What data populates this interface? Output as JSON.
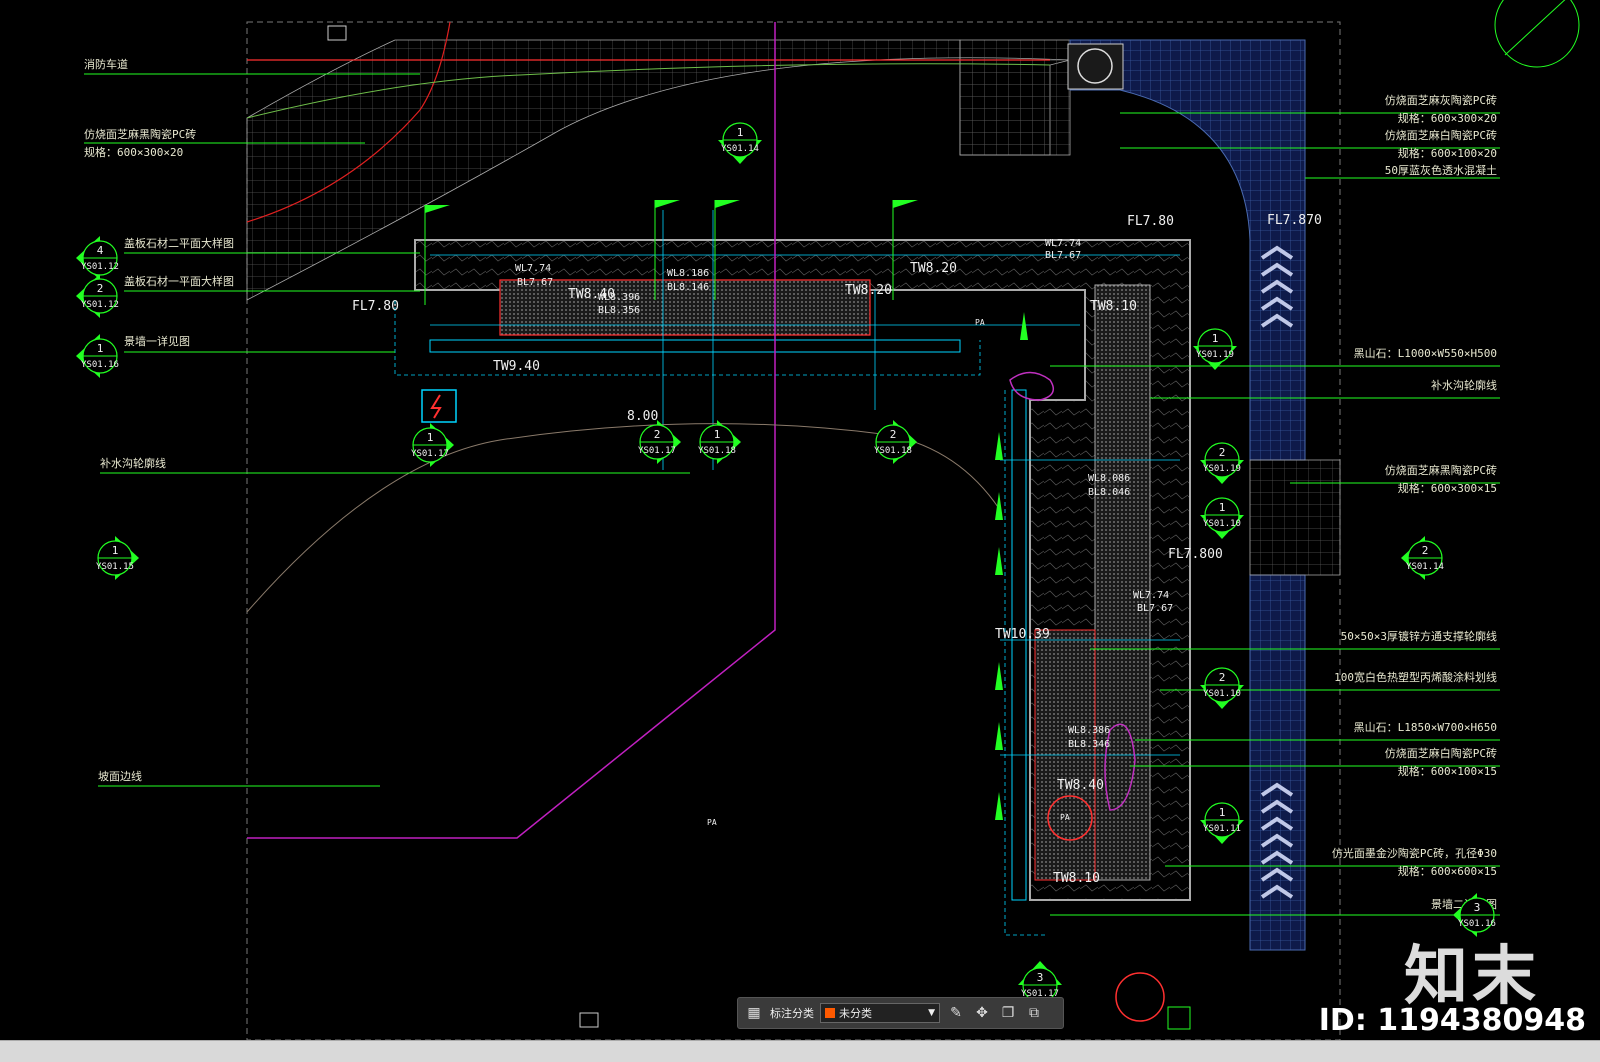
{
  "left_labels": [
    {
      "text": "消防车道"
    },
    {
      "text": "仿烧面芝麻黑陶瓷PC砖"
    },
    {
      "text": "规格：600×300×20"
    },
    {
      "text": "盖板石材二平面大样图"
    },
    {
      "text": "盖板石材一平面大样图"
    },
    {
      "text": "景墙一详见图"
    },
    {
      "text": "补水沟轮廓线"
    },
    {
      "text": "坡面边线"
    }
  ],
  "right_labels": [
    {
      "text": "仿烧面芝麻灰陶瓷PC砖"
    },
    {
      "text": "规格：600×300×20"
    },
    {
      "text": "仿烧面芝麻白陶瓷PC砖"
    },
    {
      "text": "规格：600×100×20"
    },
    {
      "text": "50厚蓝灰色透水混凝土"
    },
    {
      "text": "黑山石：L1000×W550×H500"
    },
    {
      "text": "补水沟轮廓线"
    },
    {
      "text": "仿烧面芝麻黑陶瓷PC砖"
    },
    {
      "text": "规格：600×300×15"
    },
    {
      "text": "50×50×3厚镀锌方通支撑轮廓线"
    },
    {
      "text": "100宽白色热塑型丙烯酸涂料划线"
    },
    {
      "text": "黑山石：L1850×W700×H650"
    },
    {
      "text": "仿烧面芝麻白陶瓷PC砖"
    },
    {
      "text": "规格：600×100×15"
    },
    {
      "text": "仿光面墨金沙陶瓷PC砖，孔径Φ30"
    },
    {
      "text": "规格：600×600×15"
    },
    {
      "text": "景墙二详见图"
    }
  ],
  "elevations": [
    {
      "text": "FL7.80"
    },
    {
      "text": "FL7.870"
    },
    {
      "text": "FL7.80"
    },
    {
      "text": "FL7.800"
    },
    {
      "text": "WL7.74"
    },
    {
      "text": "BL7.67"
    },
    {
      "text": "WL7.74"
    },
    {
      "text": "BL7.67"
    },
    {
      "text": "WL7.74"
    },
    {
      "text": "BL7.67"
    },
    {
      "text": "WL8.186"
    },
    {
      "text": "BL8.146"
    },
    {
      "text": "WL8.396"
    },
    {
      "text": "BL8.356"
    },
    {
      "text": "WL8.086"
    },
    {
      "text": "BL8.046"
    },
    {
      "text": "WL8.386"
    },
    {
      "text": "BL8.346"
    },
    {
      "text": "TW8.20"
    },
    {
      "text": "TW8.20"
    },
    {
      "text": "TW8.40"
    },
    {
      "text": "TW8.10"
    },
    {
      "text": "TW9.40"
    },
    {
      "text": "TW10.39"
    },
    {
      "text": "TW8.40"
    },
    {
      "text": "TW8.10"
    },
    {
      "text": "8.00"
    },
    {
      "text": "PA"
    },
    {
      "text": "PA"
    },
    {
      "text": "PA"
    }
  ],
  "section_markers": [
    {
      "num": "1",
      "ref": "YS01.14"
    },
    {
      "num": "4",
      "ref": "YS01.12"
    },
    {
      "num": "2",
      "ref": "YS01.12"
    },
    {
      "num": "1",
      "ref": "YS01.16"
    },
    {
      "num": "1",
      "ref": "YS01.17"
    },
    {
      "num": "2",
      "ref": "YS01.17"
    },
    {
      "num": "1",
      "ref": "YS01.18"
    },
    {
      "num": "2",
      "ref": "YS01.18"
    },
    {
      "num": "1",
      "ref": "YS01.15"
    },
    {
      "num": "1",
      "ref": "YS01.19"
    },
    {
      "num": "2",
      "ref": "YS01.19"
    },
    {
      "num": "1",
      "ref": "YS01.10"
    },
    {
      "num": "2",
      "ref": "YS01.10"
    },
    {
      "num": "1",
      "ref": "YS01.11"
    },
    {
      "num": "2",
      "ref": "YS01.14"
    },
    {
      "num": "3",
      "ref": "YS01.17"
    },
    {
      "num": "3",
      "ref": "YS01.16"
    }
  ],
  "toolbar": {
    "category_label": "标注分类",
    "selected_value": "未分类"
  },
  "watermark": {
    "brand": "知末",
    "id_text": "ID: 1194380948"
  },
  "colors": {
    "background": "#000000",
    "leader_green": "#22ff22",
    "cyan": "#00d5ff",
    "gray_hatch": "#888888",
    "red": "#ff3030",
    "magenta": "#c020c0",
    "blue_panel": "#1a2a6a"
  }
}
